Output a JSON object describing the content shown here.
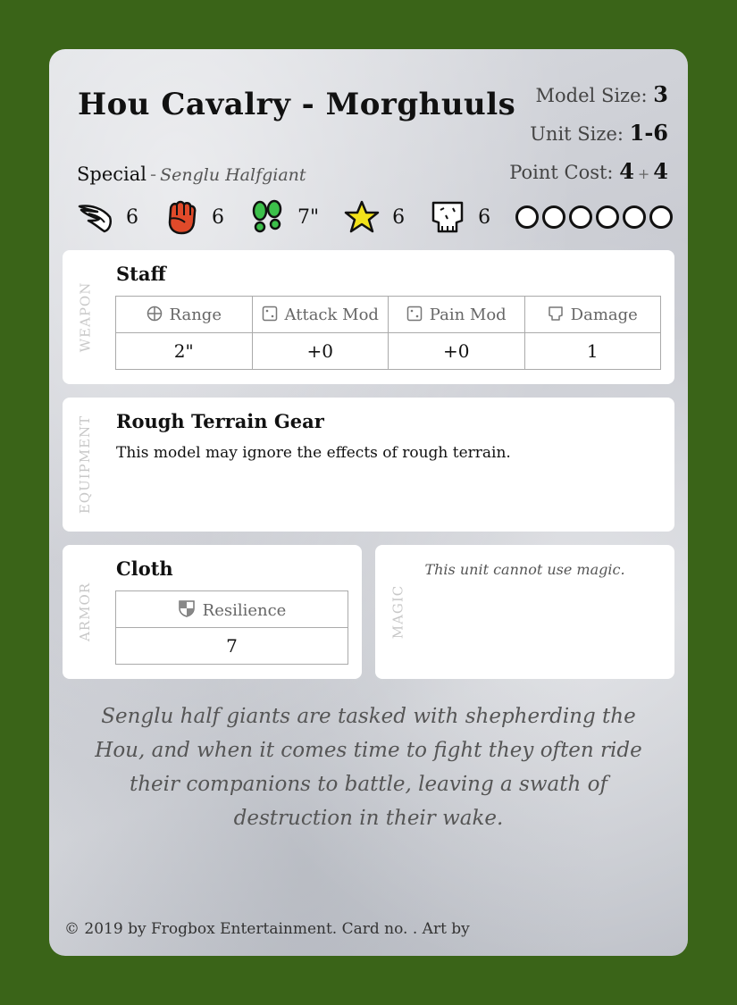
{
  "card": {
    "title": "Hou Cavalry - Morghuuls",
    "model_size_label": "Model Size:",
    "model_size": "3",
    "unit_size_label": "Unit Size:",
    "unit_size": "1-6",
    "point_cost_label": "Point Cost:",
    "point_cost_a": "4",
    "point_cost_plus": "+",
    "point_cost_b": "4",
    "special_label": "Special",
    "special_dash": "-",
    "special_value": "Senglu Halfgiant",
    "attributes": [
      {
        "icon": "wing-icon",
        "value": "6"
      },
      {
        "icon": "fist-icon",
        "value": "6"
      },
      {
        "icon": "footprints-icon",
        "value": "7\""
      },
      {
        "icon": "star-icon",
        "value": "6"
      },
      {
        "icon": "skull-icon",
        "value": "6"
      }
    ],
    "wound_circles": 6,
    "weapon": {
      "side_label": "WEAPON",
      "name": "Staff",
      "headers": [
        "Range",
        "Attack Mod",
        "Pain Mod",
        "Damage"
      ],
      "values": [
        "2\"",
        "+0",
        "+0",
        "1"
      ]
    },
    "equipment": {
      "side_label": "EQUIPMENT",
      "name": "Rough Terrain Gear",
      "text": "This model may ignore the effects of rough terrain."
    },
    "armor": {
      "side_label": "ARMOR",
      "name": "Cloth",
      "header": "Resilience",
      "value": "7"
    },
    "magic": {
      "side_label": "MAGIC",
      "text": "This unit cannot use magic."
    },
    "flavor": "Senglu half giants are tasked with shepherding the Hou, and when it comes time to fight they often ride their companions to battle, leaving a swath of destruction in their wake.",
    "footer": "© 2019 by Frogbox Entertainment. Card no. . Art by"
  },
  "colors": {
    "background": "#3a6418",
    "fist": "#e04a2a",
    "footprints": "#3cc04a",
    "star": "#f2e21a"
  }
}
